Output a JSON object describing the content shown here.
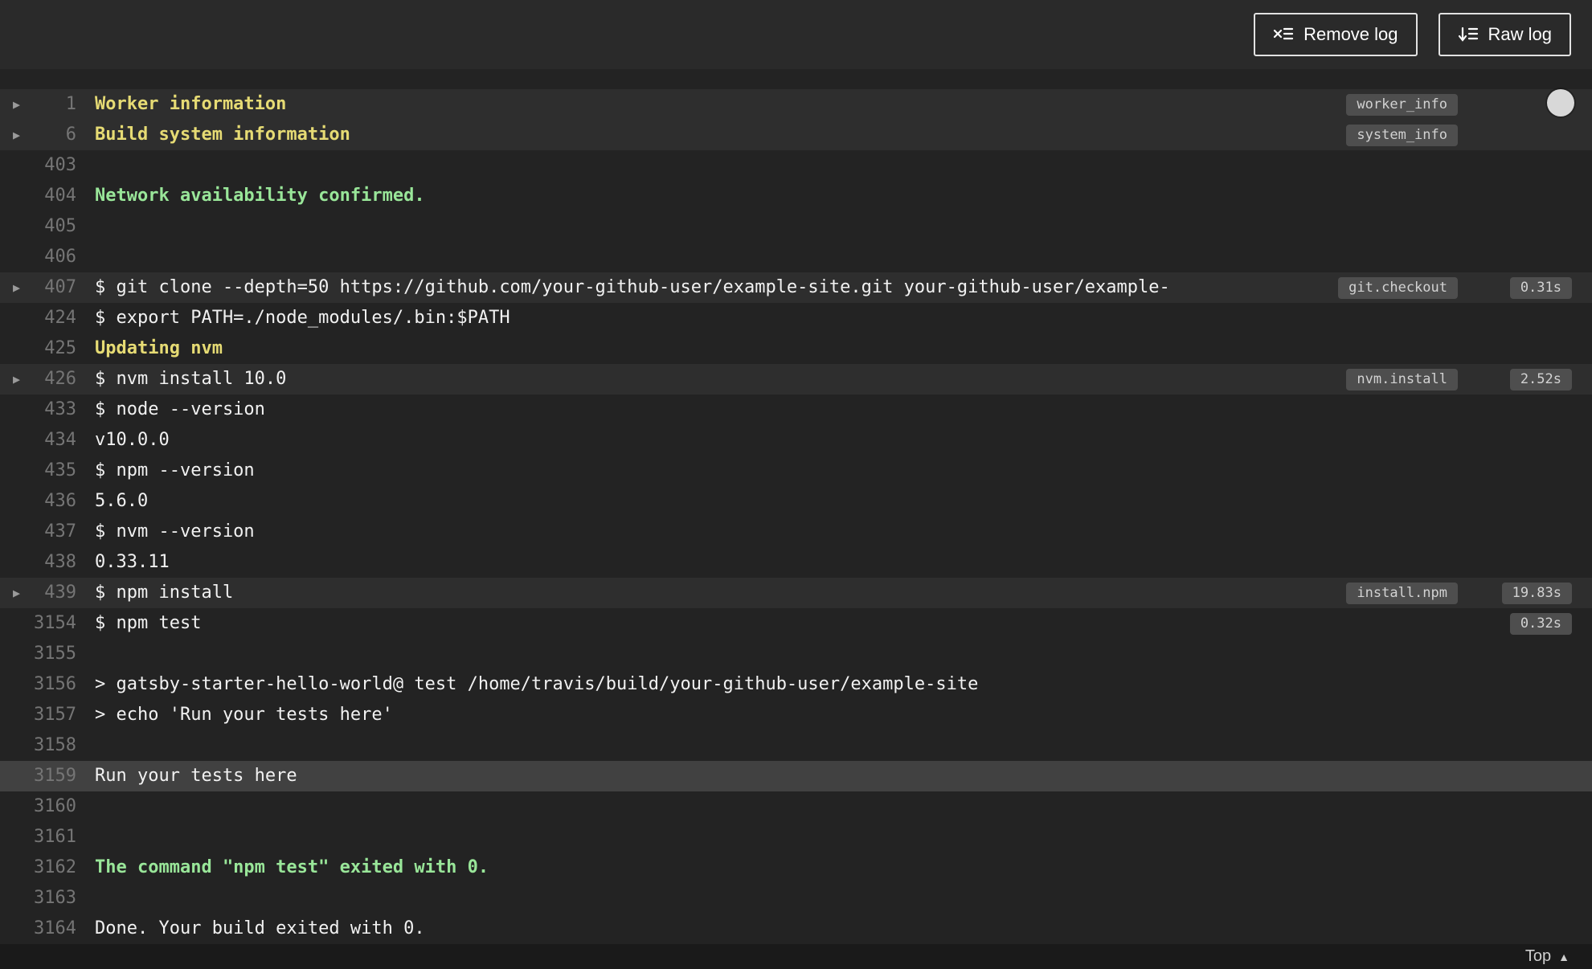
{
  "toolbar": {
    "remove_log_label": "Remove log",
    "raw_log_label": "Raw log"
  },
  "footer": {
    "top_label": "Top"
  },
  "colors": {
    "background": "#232323",
    "header_background": "#2a2a2a",
    "fold_row_background": "#2e2e2e",
    "highlight_row_background": "#414141",
    "text": "#f1f1f1",
    "line_number": "#757575",
    "yellow": "#e6db74",
    "green": "#99e699",
    "badge_background": "#4e4e4e",
    "badge_text": "#d2d2d2"
  },
  "log_lines": [
    {
      "n": "1",
      "text": "Worker information",
      "color": "yellow",
      "bold": true,
      "fold": true,
      "hl": "fold",
      "tag": "worker_info"
    },
    {
      "n": "6",
      "text": "Build system information",
      "color": "yellow",
      "bold": true,
      "fold": true,
      "hl": "fold",
      "tag": "system_info"
    },
    {
      "n": "403",
      "text": ""
    },
    {
      "n": "404",
      "text": "Network availability confirmed.",
      "color": "green",
      "bold": true
    },
    {
      "n": "405",
      "text": ""
    },
    {
      "n": "406",
      "text": ""
    },
    {
      "n": "407",
      "text": "$ git clone --depth=50 https://github.com/your-github-user/example-site.git your-github-user/example-",
      "fold": true,
      "hl": "fold",
      "tag": "git.checkout",
      "duration": "0.31s"
    },
    {
      "n": "424",
      "text": "$ export PATH=./node_modules/.bin:$PATH"
    },
    {
      "n": "425",
      "text": "Updating nvm",
      "color": "yellow",
      "bold": true
    },
    {
      "n": "426",
      "text": "$ nvm install 10.0",
      "fold": true,
      "hl": "fold",
      "tag": "nvm.install",
      "duration": "2.52s"
    },
    {
      "n": "433",
      "text": "$ node --version"
    },
    {
      "n": "434",
      "text": "v10.0.0"
    },
    {
      "n": "435",
      "text": "$ npm --version"
    },
    {
      "n": "436",
      "text": "5.6.0"
    },
    {
      "n": "437",
      "text": "$ nvm --version"
    },
    {
      "n": "438",
      "text": "0.33.11"
    },
    {
      "n": "439",
      "text": "$ npm install",
      "fold": true,
      "hl": "fold",
      "tag": "install.npm",
      "duration": "19.83s"
    },
    {
      "n": "3154",
      "text": "$ npm test",
      "duration": "0.32s"
    },
    {
      "n": "3155",
      "text": ""
    },
    {
      "n": "3156",
      "text": "> gatsby-starter-hello-world@ test /home/travis/build/your-github-user/example-site"
    },
    {
      "n": "3157",
      "text": "> echo 'Run your tests here'"
    },
    {
      "n": "3158",
      "text": ""
    },
    {
      "n": "3159",
      "text": "Run your tests here",
      "hl": "strong"
    },
    {
      "n": "3160",
      "text": ""
    },
    {
      "n": "3161",
      "text": ""
    },
    {
      "n": "3162",
      "text": "The command \"npm test\" exited with 0.",
      "color": "green",
      "bold": true
    },
    {
      "n": "3163",
      "text": ""
    },
    {
      "n": "3164",
      "text": "Done. Your build exited with 0."
    }
  ]
}
